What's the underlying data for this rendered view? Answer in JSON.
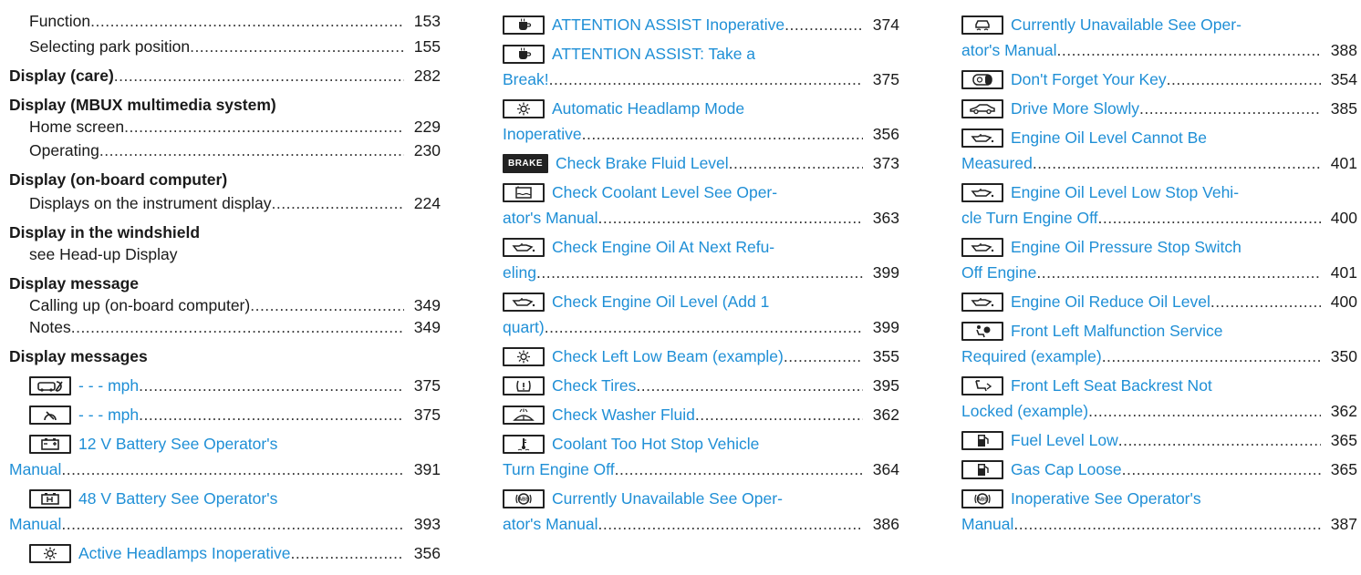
{
  "col1": {
    "function_label": "Function",
    "function_page": "153",
    "park_label": "Selecting park position",
    "park_page": "155",
    "care_label": "Display (care)",
    "care_page": "282",
    "mbux_head": "Display (MBUX multimedia system)",
    "home_label": "Home screen",
    "home_page": "229",
    "operating_label": "Operating",
    "operating_page": "230",
    "onboard_head": "Display (on-board computer)",
    "instrument_label": "Displays on the instrument display",
    "instrument_page": "224",
    "windshield_head": "Display in the windshield",
    "hud_label": "see Head-up Display",
    "message_head": "Display message",
    "calling_label": "Calling up (on-board computer)",
    "calling_page": "349",
    "notes_label": "Notes",
    "notes_page": "349",
    "messages_head": "Display messages",
    "mph1_label": "- - - mph",
    "mph1_page": "375",
    "mph2_label": "- - - mph",
    "mph2_page": "375",
    "batt12_line1": "12 V Battery See Operator's",
    "batt12_line2": "Manual",
    "batt12_page": "391",
    "batt48_line1": "48 V Battery See Operator's",
    "batt48_line2": "Manual",
    "batt48_page": "393",
    "active_label": "Active Headlamps Inoperative",
    "active_page": "356"
  },
  "col2": {
    "aa_inop_label": "ATTENTION ASSIST Inoperative",
    "aa_inop_page": "374",
    "aa_break_line1": "ATTENTION ASSIST: Take a",
    "aa_break_line2": "Break!",
    "aa_break_page": "375",
    "auto_line1": "Automatic Headlamp Mode",
    "auto_line2": "Inoperative",
    "auto_page": "356",
    "brake_icon_text": "BRAKE",
    "brake_label": "Check Brake Fluid Level",
    "brake_page": "373",
    "coolant_line1": "Check Coolant Level See Oper-",
    "coolant_line2": "ator's Manual",
    "coolant_page": "363",
    "oilnext_line1": "Check Engine Oil At Next Refu-",
    "oilnext_line2": "eling",
    "oilnext_page": "399",
    "oillevel_line1": "Check Engine Oil Level (Add 1",
    "oillevel_line2": "quart)",
    "oillevel_page": "399",
    "lowbeam_label": "Check Left Low Beam (example)",
    "lowbeam_page": "355",
    "tires_label": "Check Tires",
    "tires_page": "395",
    "washer_label": "Check Washer Fluid",
    "washer_page": "362",
    "hot_line1": "Coolant Too Hot Stop Vehicle",
    "hot_line2": "Turn Engine Off",
    "hot_page": "364",
    "abs_line1": "Currently Unavailable See Oper-",
    "abs_line2": "ator's Manual",
    "abs_page": "386"
  },
  "col3": {
    "cu_line1": "Currently Unavailable See Oper-",
    "cu_line2": "ator's Manual",
    "cu_page": "388",
    "key_label": "Don't Forget Your Key",
    "key_page": "354",
    "slow_label": "Drive More Slowly",
    "slow_page": "385",
    "oilmeas_line1": "Engine Oil Level Cannot Be",
    "oilmeas_line2": "Measured",
    "oilmeas_page": "401",
    "oillow_line1": "Engine Oil Level Low Stop Vehi-",
    "oillow_line2": "cle Turn Engine Off",
    "oillow_page": "400",
    "oilpress_line1": "Engine Oil Pressure Stop Switch",
    "oilpress_line2": "Off Engine",
    "oilpress_page": "401",
    "oilreduce_label": "Engine Oil Reduce Oil Level",
    "oilreduce_page": "400",
    "frontleft_line1": "Front Left Malfunction Service",
    "frontleft_line2": "Required (example)",
    "frontleft_page": "350",
    "seat_line1": "Front Left Seat Backrest Not",
    "seat_line2": "Locked (example)",
    "seat_page": "362",
    "fuel_label": "Fuel Level Low",
    "fuel_page": "365",
    "gascap_label": "Gas Cap Loose",
    "gascap_page": "365",
    "inop_line1": "Inoperative See Operator's",
    "inop_line2": "Manual",
    "inop_page": "387"
  },
  "colors": {
    "link": "#1f8fd6",
    "text": "#1a1a1a",
    "icon_border": "#222222"
  }
}
